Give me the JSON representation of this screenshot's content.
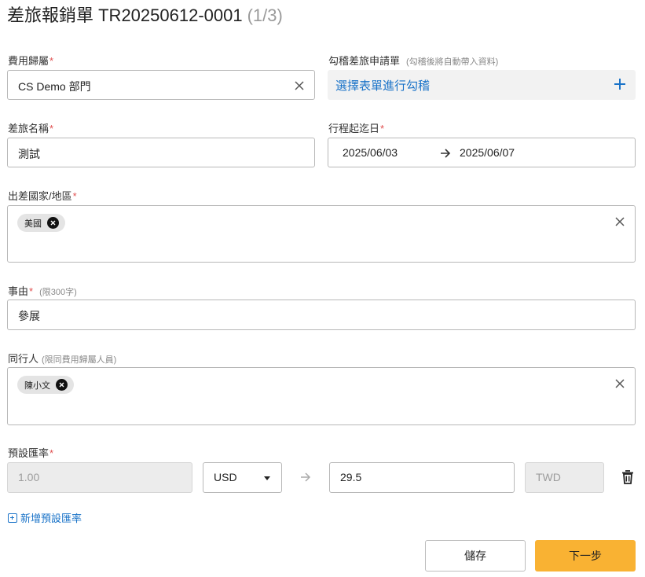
{
  "header": {
    "title": "差旅報銷單 TR20250612-0001",
    "pager": "(1/3)"
  },
  "colors": {
    "accent_link": "#1a73c8",
    "required_mark": "#e05050",
    "primary_button": "#f9b233"
  },
  "form": {
    "cost_owner": {
      "label": "費用歸屬",
      "required_mark": "*",
      "value": "CS Demo 部門"
    },
    "trip_application": {
      "label": "勾稽差旅申請單",
      "hint": "(勾稽後將自動帶入資料)",
      "link_text": "選擇表單進行勾稽",
      "icon": "plus-icon"
    },
    "trip_name": {
      "label": "差旅名稱",
      "required_mark": "*",
      "value": "測試"
    },
    "trip_dates": {
      "label": "行程起迄日",
      "required_mark": "*",
      "start": "2025/06/03",
      "end": "2025/06/07",
      "icon": "arrow-right-icon"
    },
    "countries": {
      "label": "出差國家/地區",
      "required_mark": "*",
      "chips": [
        "美國"
      ]
    },
    "reason": {
      "label": "事由",
      "required_mark": "*",
      "hint": "(限300字)",
      "value": "參展"
    },
    "companions": {
      "label": "同行人",
      "hint": "(限同費用歸屬人員)",
      "chips": [
        "陳小文"
      ]
    },
    "exchange_rate": {
      "label": "預設匯率",
      "required_mark": "*",
      "base_amount": "1.00",
      "currency": "USD",
      "rate_value": "29.5",
      "target_currency": "TWD",
      "icons": [
        "arrow-right-icon",
        "trash-icon"
      ]
    },
    "add_rate_link": "新增預設匯率"
  },
  "actions": {
    "save_label": "儲存",
    "next_label": "下一步"
  }
}
